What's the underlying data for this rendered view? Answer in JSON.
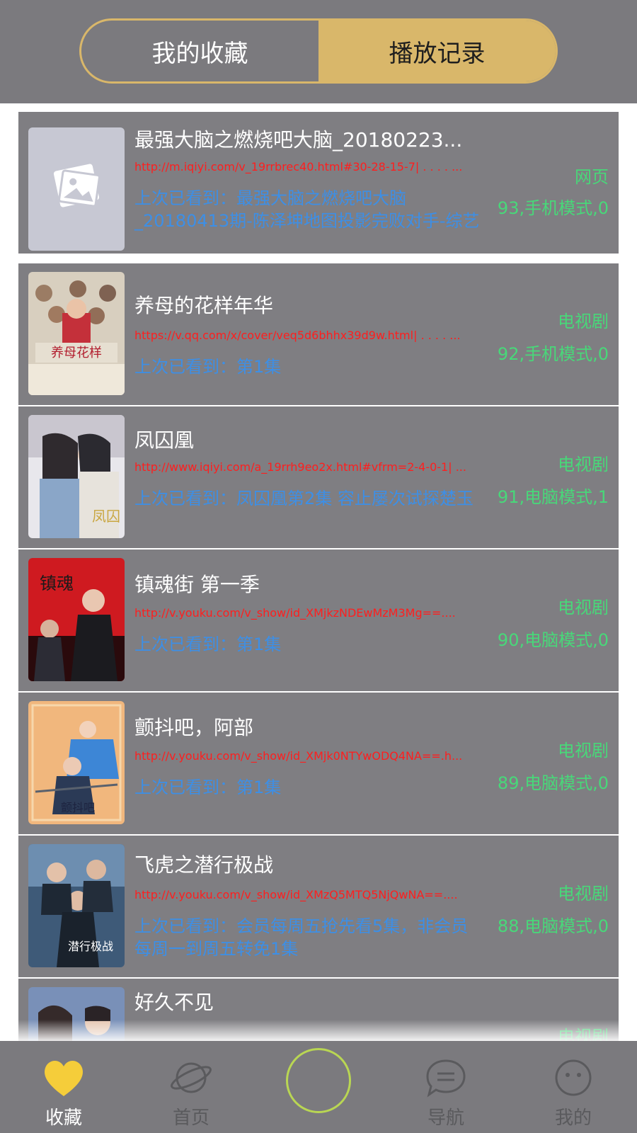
{
  "tabs": {
    "favorites": "我的收藏",
    "history": "播放记录"
  },
  "items": [
    {
      "title": "最强大脑之燃烧吧大脑_20180223...",
      "url": "http://m.iqiyi.com/v_19rrbrec40.html#30-28-15-7| . . . . ...",
      "last": "上次已看到：最强大脑之燃烧吧大脑_20180413期-陈泽坤地图投影完败对手-综艺",
      "type": "网页",
      "meta": "93,手机模式,0"
    },
    {
      "title": "养母的花样年华",
      "url": "https://v.qq.com/x/cover/veq5d6bhhx39d9w.html| . . . . ...",
      "last": "上次已看到：第1集",
      "type": "电视剧",
      "meta": "92,手机模式,0"
    },
    {
      "title": "凤囚凰",
      "url": "http://www.iqiyi.com/a_19rrh9eo2x.html#vfrm=2-4-0-1| ...",
      "last": "上次已看到：凤囚凰第2集 容止屡次试探楚玉",
      "type": "电视剧",
      "meta": "91,电脑模式,1"
    },
    {
      "title": "镇魂街 第一季",
      "url": "http://v.youku.com/v_show/id_XMjkzNDEwMzM3Mg==....",
      "last": "上次已看到：第1集",
      "type": "电视剧",
      "meta": "90,电脑模式,0"
    },
    {
      "title": "颤抖吧，阿部",
      "url": "http://v.youku.com/v_show/id_XMjk0NTYwODQ4NA==.h...",
      "last": "上次已看到：第1集",
      "type": "电视剧",
      "meta": "89,电脑模式,0"
    },
    {
      "title": "飞虎之潜行极战",
      "url": "http://v.youku.com/v_show/id_XMzQ5MTQ5NjQwNA==....",
      "last": "上次已看到：会员每周五抢先看5集，非会员每周一到周五转免1集",
      "type": "电视剧",
      "meta": "88,电脑模式,0"
    },
    {
      "title": "好久不见",
      "url": "",
      "last": "",
      "type": "电视剧",
      "meta": ""
    }
  ],
  "nav": {
    "favorites": "收藏",
    "home": "首页",
    "guide": "导航",
    "mine": "我的"
  },
  "colors": {
    "accent": "#d9b76a",
    "row_bg": "#7f7e82",
    "title": "#ffffff",
    "url": "#ff1e1e",
    "last": "#3d8fe6",
    "meta": "#48d879",
    "heart": "#f5cd3a"
  }
}
